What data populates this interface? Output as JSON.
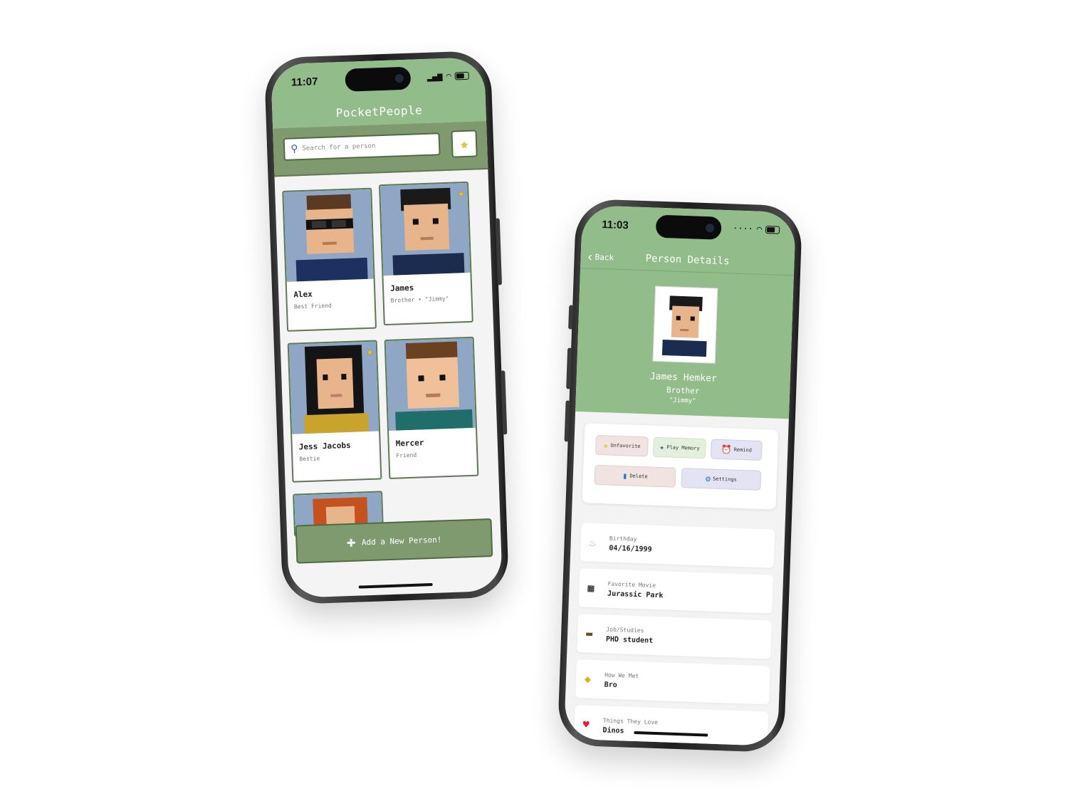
{
  "phone1": {
    "status_time": "11:07",
    "app_title": "PocketPeople",
    "search_placeholder": "Search for a person",
    "people": [
      {
        "name": "Alex",
        "subtitle": "Best Friend",
        "favorite": false
      },
      {
        "name": "James",
        "subtitle": "Brother • \"Jimmy\"",
        "favorite": true
      },
      {
        "name": "Jess Jacobs",
        "subtitle": "Bestie",
        "favorite": true
      },
      {
        "name": "Mercer",
        "subtitle": "Friend",
        "favorite": false
      }
    ],
    "add_button_label": "Add a New Person!"
  },
  "phone2": {
    "status_time": "11:03",
    "back_label": "Back",
    "nav_title": "Person Details",
    "person_name": "James Hemker",
    "relation": "Brother",
    "nickname": "\"Jimmy\"",
    "actions": {
      "unfavorite": "Unfavorite",
      "play_memory": "Play Memory",
      "remind": "Remind",
      "delete": "Delete",
      "settings": "Settings"
    },
    "details": [
      {
        "label": "Birthday",
        "value": "04/16/1999",
        "icon": "cake-icon"
      },
      {
        "label": "Favorite Movie",
        "value": "Jurassic Park",
        "icon": "clapperboard-icon"
      },
      {
        "label": "Job/Studies",
        "value": "PHD student",
        "icon": "briefcase-icon"
      },
      {
        "label": "How We Met",
        "value": "Bro",
        "icon": "handshake-icon"
      },
      {
        "label": "Things They Love",
        "value": "Dinos",
        "icon": "heart-icon"
      }
    ]
  },
  "colors": {
    "header_green": "#92bc8a",
    "bar_green": "#7f9a6f",
    "border_green": "#4f6b44",
    "portrait_bg": "#8fa7c4"
  }
}
